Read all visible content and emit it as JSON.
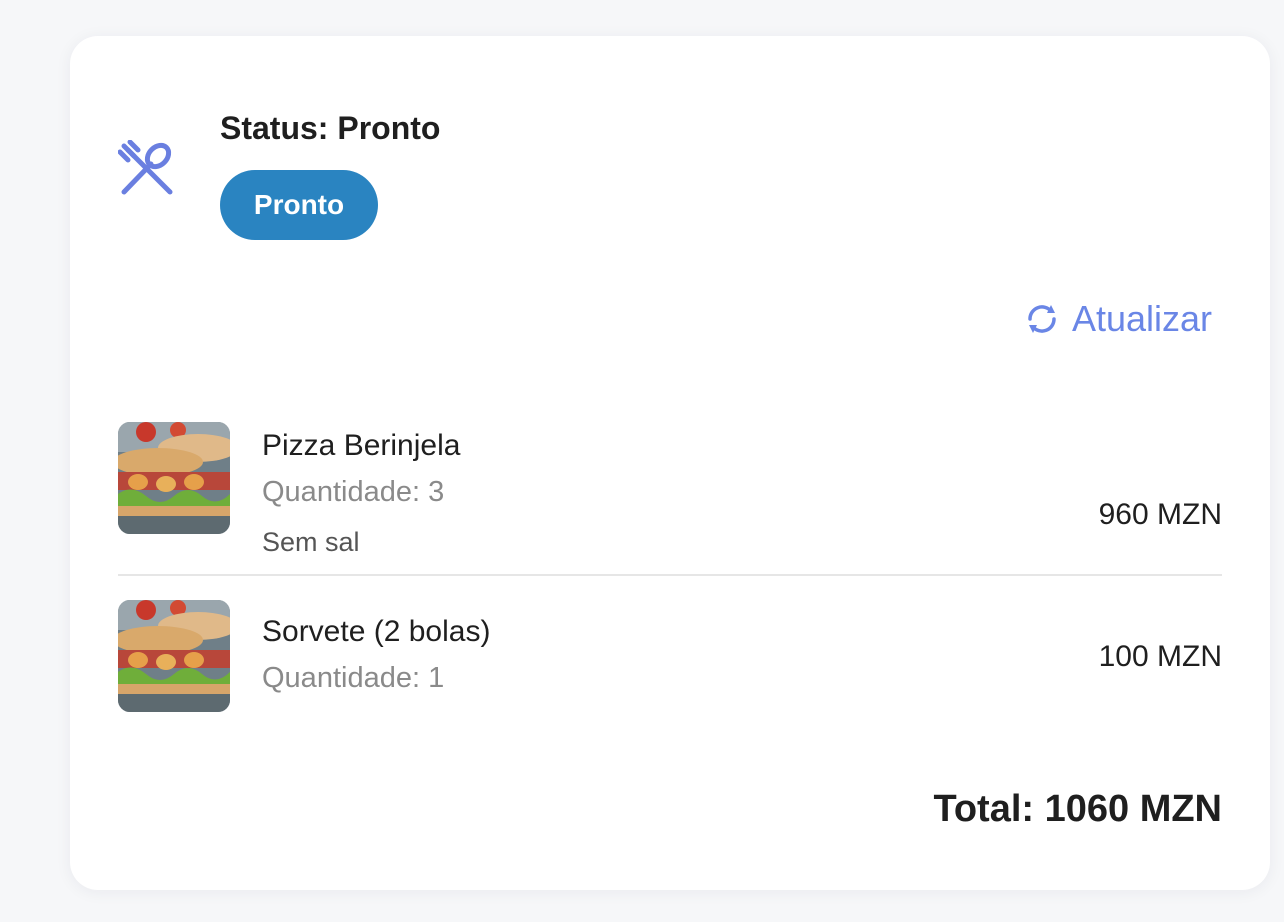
{
  "order": {
    "status_title": "Status: Pronto",
    "status_badge": "Pronto",
    "status_icon": "utensils-icon",
    "badge_color": "#2a84c1",
    "accent_color": "#6a86e6"
  },
  "actions": {
    "refresh_label": "Atualizar",
    "refresh_icon": "refresh-icon"
  },
  "items": [
    {
      "name": "Pizza Berinjela",
      "quantity": "Quantidade: 3",
      "note": "Sem sal",
      "price": "960 MZN",
      "image_icon": "sandwich-image"
    },
    {
      "name": "Sorvete (2 bolas)",
      "quantity": "Quantidade: 1",
      "price": "100 MZN",
      "image_icon": "sandwich-image"
    }
  ],
  "summary": {
    "total": "Total: 1060 MZN"
  }
}
